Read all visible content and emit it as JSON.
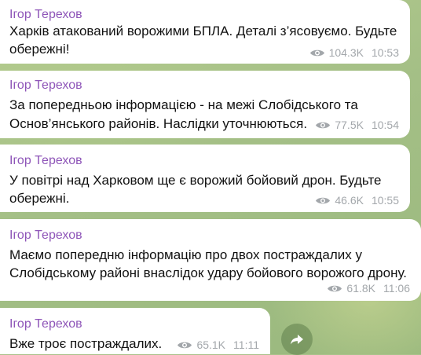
{
  "messages": [
    {
      "sender": "Ігор Терехов",
      "lines": [
        "Харків атакований ворожими БПЛА. Деталі з’ясовуємо. Будьте",
        "обережні!"
      ],
      "views": "104.3K",
      "time": "10:53"
    },
    {
      "sender": "Ігор Терехов",
      "lines": [
        "За попередньою інформацією - на межі Слобідського та",
        "Основ’янського районів. Наслідки уточнюються."
      ],
      "views": "77.5K",
      "time": "10:54"
    },
    {
      "sender": "Ігор Терехов",
      "lines": [
        "У повітрі над Харковом ще є ворожий бойовий дрон. Будьте",
        "обережні."
      ],
      "views": "46.6K",
      "time": "10:55"
    },
    {
      "sender": "Ігор Терехов",
      "lines": [
        "Маємо попередню інформацію про двох постраждалих у",
        "Слобідському районі внаслідок удару бойового ворожого дрону."
      ],
      "views": "61.8K",
      "time": "11:06"
    },
    {
      "sender": "Ігор Терехов",
      "lines": [
        "Вже троє постраждалих."
      ],
      "views": "65.1K",
      "time": "11:11"
    }
  ],
  "icons": {
    "views": "eye-icon",
    "share": "share-arrow-icon"
  },
  "colors": {
    "sender": "#8e55b8",
    "bubble": "#ffffff",
    "meta": "#a3a7ab",
    "background": "#a9c28a"
  }
}
